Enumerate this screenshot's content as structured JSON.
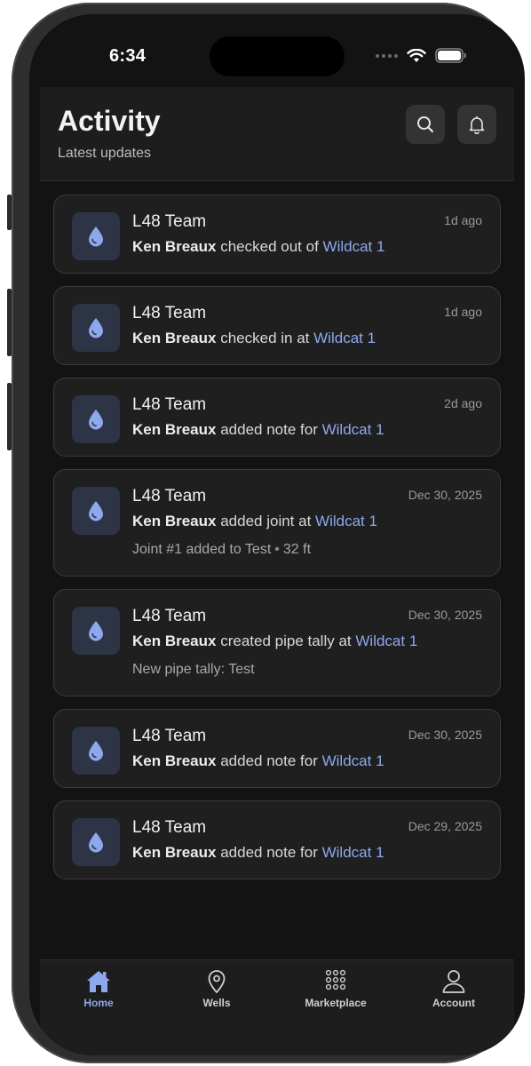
{
  "status_bar": {
    "time": "6:34"
  },
  "header": {
    "title": "Activity",
    "subtitle": "Latest updates"
  },
  "feed": [
    {
      "team": "L48 Team",
      "time": "1d ago",
      "actor": "Ken Breaux",
      "action": "checked out of",
      "target": "Wildcat 1",
      "detail": null
    },
    {
      "team": "L48 Team",
      "time": "1d ago",
      "actor": "Ken Breaux",
      "action": "checked in at",
      "target": "Wildcat 1",
      "detail": null
    },
    {
      "team": "L48 Team",
      "time": "2d ago",
      "actor": "Ken Breaux",
      "action": "added note for",
      "target": "Wildcat 1",
      "detail": null
    },
    {
      "team": "L48 Team",
      "time": "Dec 30, 2025",
      "actor": "Ken Breaux",
      "action": "added joint at",
      "target": "Wildcat 1",
      "detail": "Joint #1 added to Test",
      "detail_extra": "32 ft"
    },
    {
      "team": "L48 Team",
      "time": "Dec 30, 2025",
      "actor": "Ken Breaux",
      "action": "created pipe tally at",
      "target": "Wildcat 1",
      "detail": "New pipe tally: Test"
    },
    {
      "team": "L48 Team",
      "time": "Dec 30, 2025",
      "actor": "Ken Breaux",
      "action": "added note for",
      "target": "Wildcat 1",
      "detail": null
    },
    {
      "team": "L48 Team",
      "time": "Dec 29, 2025",
      "actor": "Ken Breaux",
      "action": "added note for",
      "target": "Wildcat 1",
      "detail": null
    }
  ],
  "tabbar": {
    "items": [
      {
        "label": "Home",
        "icon": "home-icon",
        "active": true
      },
      {
        "label": "Wells",
        "icon": "map-pin-icon",
        "active": false
      },
      {
        "label": "Marketplace",
        "icon": "grid-icon",
        "active": false
      },
      {
        "label": "Account",
        "icon": "user-icon",
        "active": false
      }
    ]
  },
  "colors": {
    "accent": "#8ea8ee",
    "background": "#131313",
    "card": "#1f1f1f",
    "icon_tile": "#2d3446"
  }
}
